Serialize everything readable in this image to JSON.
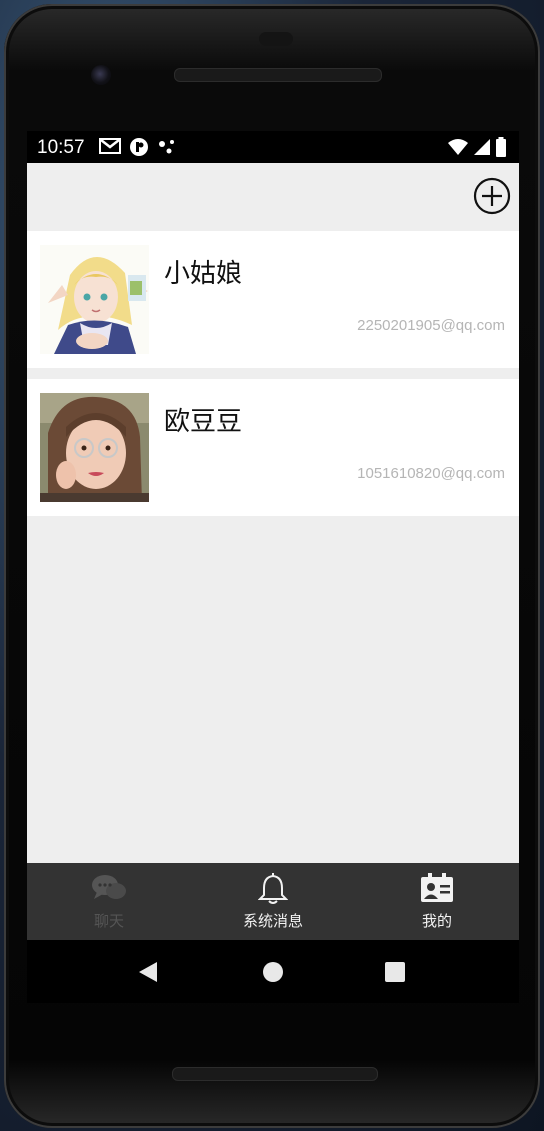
{
  "status_bar": {
    "time": "10:57",
    "left_icons": [
      "gmail-icon",
      "app-icon",
      "dots-icon"
    ],
    "right_icons": [
      "wifi-icon",
      "signal-icon",
      "battery-icon"
    ]
  },
  "toolbar": {
    "add_icon": "plus-circle-icon"
  },
  "contacts": [
    {
      "name": "小姑娘",
      "email": "2250201905@qq.com",
      "avatar": "anime-elf-girl-avatar"
    },
    {
      "name": "欧豆豆",
      "email": "1051610820@qq.com",
      "avatar": "photo-girl-avatar"
    }
  ],
  "tabs": [
    {
      "label": "聊天",
      "icon": "chat-bubbles-icon",
      "active": false
    },
    {
      "label": "系统消息",
      "icon": "bell-icon",
      "active": true
    },
    {
      "label": "我的",
      "icon": "contact-card-icon",
      "active": true
    }
  ],
  "colors": {
    "tab_bar_bg": "#333333",
    "tab_inactive": "#555555",
    "tab_active": "#f2f2f2",
    "list_bg": "#eeeeee",
    "email_text": "#b5b5b5"
  }
}
